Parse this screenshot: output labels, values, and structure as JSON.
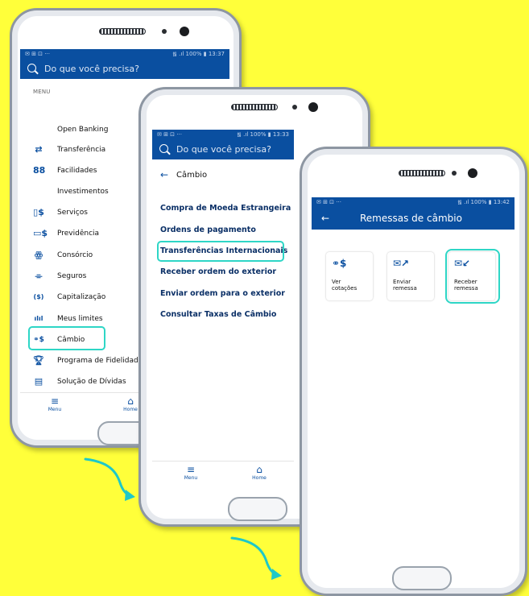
{
  "phone1": {
    "status_left": "✉ ⊞ ⊡  ···",
    "status_right": "᯾ .ıl 100% ▮ 13:37",
    "search_placeholder": "Do que você precisa?",
    "menu_header": "MENU",
    "items": [
      {
        "icon": "",
        "label": "Open Banking"
      },
      {
        "icon": "⇄",
        "label": "Transferência"
      },
      {
        "icon": "88",
        "label": "Facilidades"
      },
      {
        "icon": "",
        "label": "Investimentos"
      },
      {
        "icon": "▯$",
        "label": "Serviços"
      },
      {
        "icon": "▭$",
        "label": "Previdência"
      },
      {
        "icon": "ꙮ",
        "label": "Consórcio"
      },
      {
        "icon": "⌯",
        "label": "Seguros"
      },
      {
        "icon": "($)",
        "label": "Capitalização"
      },
      {
        "icon": "ılıl",
        "label": "Meus limites"
      },
      {
        "icon": "⚭$",
        "label": "Câmbio"
      },
      {
        "icon": "🏆︎",
        "label": "Programa de Fidelidade"
      },
      {
        "icon": "▤",
        "label": "Solução de Dívidas"
      }
    ],
    "nav": {
      "menu": "Menu",
      "home": "Home"
    }
  },
  "phone2": {
    "status_left": "✉ ⊞ ⊡  ···",
    "status_right": "᯾ .ıl 100% ▮ 13:33",
    "search_placeholder": "Do que você precisa?",
    "title": "Câmbio",
    "options": [
      "Compra de Moeda Estrangeira",
      "Ordens de pagamento",
      "Transferências Internacionais",
      "Receber ordem do exterior",
      "Enviar ordem para o exterior",
      "Consultar Taxas de Câmbio"
    ],
    "nav": {
      "menu": "Menu",
      "home": "Home"
    }
  },
  "phone3": {
    "status_left": "✉ ⊞ ⊡  ···",
    "status_right": "᯾ .ıl 100% ▮ 13:42",
    "header_title": "Remessas de câmbio",
    "cards": [
      {
        "icon": "⚭$",
        "line1": "Ver",
        "line2": "cotações"
      },
      {
        "icon": "✉↗",
        "line1": "Enviar",
        "line2": "remessa"
      },
      {
        "icon": "✉↙",
        "line1": "Receber",
        "line2": "remessa"
      }
    ]
  },
  "colors": {
    "background": "#FFFF3A",
    "brand_blue": "#0A4FA0",
    "highlight": "#2ED6C6",
    "arrow": "#1EC8C8"
  }
}
